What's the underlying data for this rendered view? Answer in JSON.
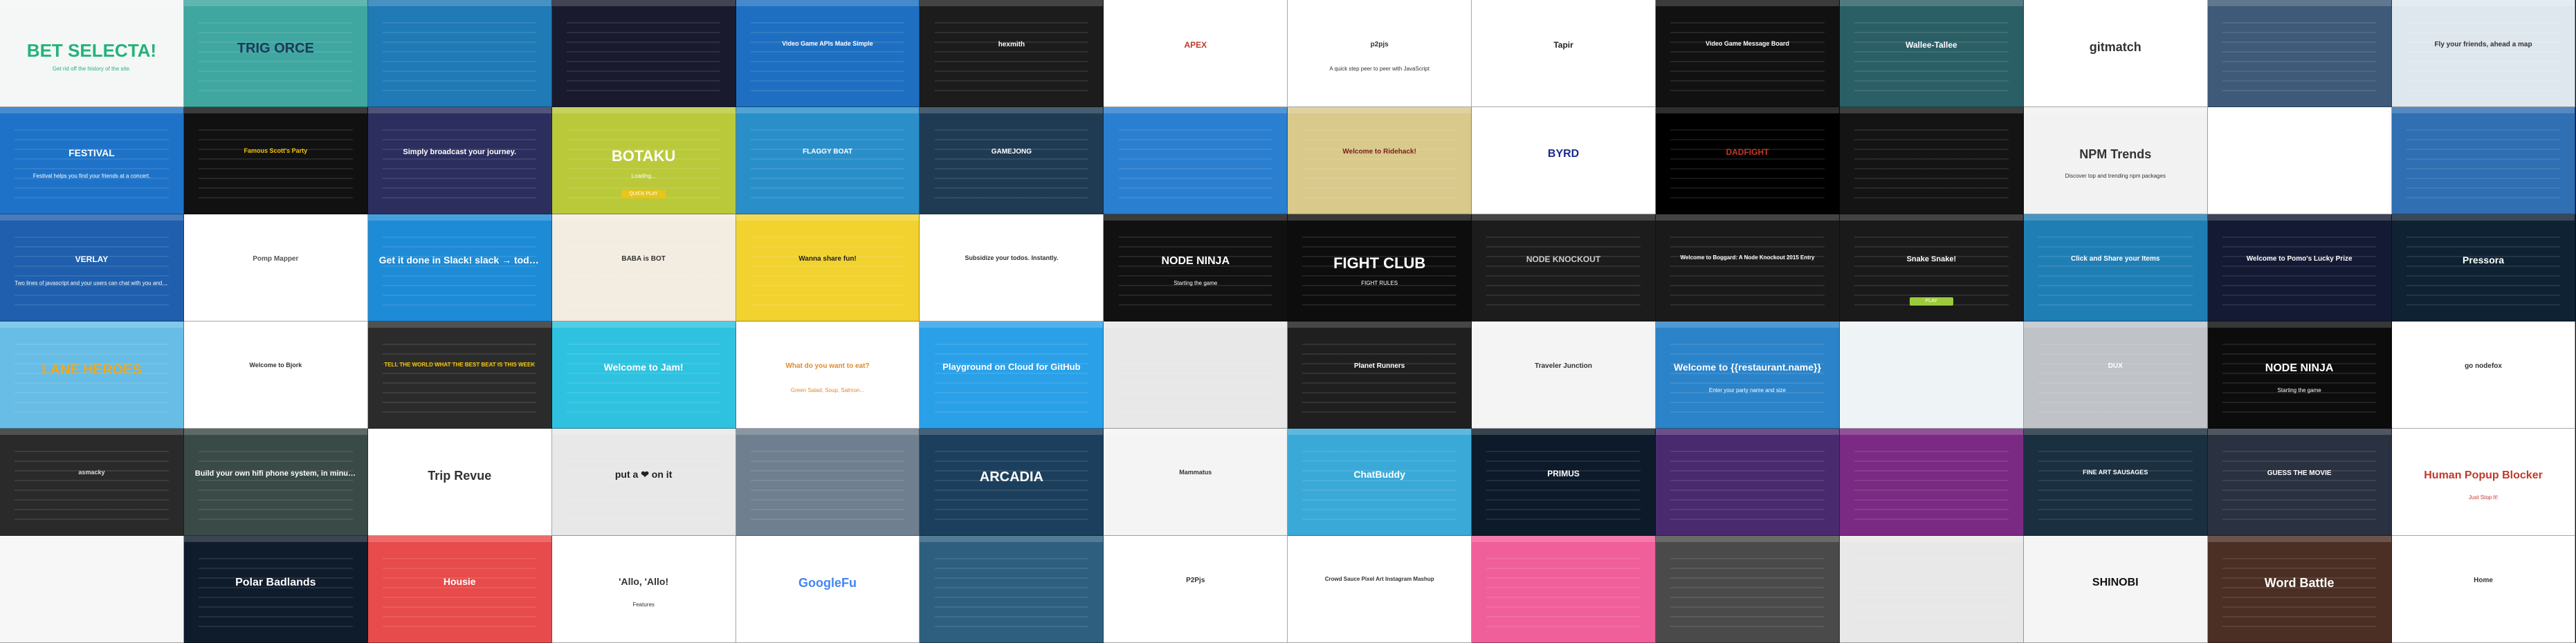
{
  "tiles": [
    {
      "title": "BET SELECTA!",
      "sub": "Get rid off the history of the site.",
      "bg": "#f4f7f6",
      "fg": "#23b27a",
      "btn": "",
      "size": 26
    },
    {
      "title": "TRIG ORCE",
      "sub": "",
      "bg": "#3fa7a0",
      "fg": "#1b3a5a",
      "btn": "",
      "size": 20
    },
    {
      "title": "",
      "sub": "",
      "bg": "#1f7ab5",
      "fg": "#ffffff",
      "btn": "",
      "size": 14
    },
    {
      "title": "",
      "sub": "",
      "bg": "#1a1a2e",
      "fg": "#ffffff",
      "btn": "",
      "size": 12
    },
    {
      "title": "Video Game APIs Made Simple",
      "sub": "",
      "bg": "#1e6fc2",
      "fg": "#ffffff",
      "btn": "",
      "size": 9
    },
    {
      "title": "hexmith",
      "sub": "",
      "bg": "#1c1c1c",
      "fg": "#ffffff",
      "btn": "",
      "size": 10
    },
    {
      "title": "APEX",
      "sub": "",
      "bg": "#ffffff",
      "fg": "#c0392b",
      "btn": "",
      "size": 12
    },
    {
      "title": "p2pjs",
      "sub": "A quick step peer to peer with JavaScript",
      "bg": "#ffffff",
      "fg": "#333333",
      "btn": "",
      "size": 10
    },
    {
      "title": "Tapir",
      "sub": "",
      "bg": "#ffffff",
      "fg": "#222222",
      "btn": "",
      "size": 12
    },
    {
      "title": "Video Game Message Board",
      "sub": "",
      "bg": "#111111",
      "fg": "#ffffff",
      "btn": "",
      "size": 9
    },
    {
      "title": "Wallee-Tallee",
      "sub": "",
      "bg": "#2b5f66",
      "fg": "#ffffff",
      "btn": "",
      "size": 12
    },
    {
      "title": "gitmatch",
      "sub": "",
      "bg": "#ffffff",
      "fg": "#333333",
      "btn": "",
      "size": 18
    },
    {
      "title": "",
      "sub": "",
      "bg": "#3e5a78",
      "fg": "#ffffff",
      "btn": "",
      "size": 12
    },
    {
      "title": "Fly your friends, ahead a map",
      "sub": "",
      "bg": "#dfe7ee",
      "fg": "#333333",
      "btn": "",
      "size": 10
    },
    {
      "title": "FESTIVAL",
      "sub": "Festival helps you find your friends at a concert.",
      "bg": "#1e73c8",
      "fg": "#ffffff",
      "btn": "",
      "size": 14
    },
    {
      "title": "Famous Scott's Party",
      "sub": "",
      "bg": "#111111",
      "fg": "#f1c40f",
      "btn": "",
      "size": 9
    },
    {
      "title": "Simply broadcast your journey.",
      "sub": "",
      "bg": "#2c2f5e",
      "fg": "#ffffff",
      "btn": "",
      "size": 11
    },
    {
      "title": "BOTAKU",
      "sub": "Loading...",
      "bg": "#b9c93a",
      "fg": "#ffffff",
      "btn": "QUICK PLAY",
      "btnbg": "#e8c51a",
      "size": 22
    },
    {
      "title": "FLAGGY BOAT",
      "sub": "",
      "bg": "#2a8fc9",
      "fg": "#ffffff",
      "btn": "",
      "size": 10
    },
    {
      "title": "GAMEJONG",
      "sub": "",
      "bg": "#1f3b54",
      "fg": "#ffffff",
      "btn": "",
      "size": 10
    },
    {
      "title": "",
      "sub": "",
      "bg": "#2b7fd0",
      "fg": "#ffffff",
      "btn": "",
      "size": 12
    },
    {
      "title": "Welcome to Ridehack!",
      "sub": "",
      "bg": "#d9c98a",
      "fg": "#7a1f1f",
      "btn": "",
      "size": 10
    },
    {
      "title": "BYRD",
      "sub": "",
      "bg": "#ffffff",
      "fg": "#1b2a8a",
      "btn": "",
      "size": 16
    },
    {
      "title": "DADFIGHT",
      "sub": "",
      "bg": "#000000",
      "fg": "#c0392b",
      "btn": "",
      "size": 12
    },
    {
      "title": "",
      "sub": "",
      "bg": "#141414",
      "fg": "#ffffff",
      "btn": "",
      "size": 12
    },
    {
      "title": "NPM Trends",
      "sub": "Discover top and trending npm packages",
      "bg": "#f2f2f2",
      "fg": "#333333",
      "btn": "",
      "size": 18
    },
    {
      "title": "",
      "sub": "",
      "bg": "#ffffff",
      "fg": "#333333",
      "btn": "",
      "size": 12
    },
    {
      "title": "",
      "sub": "",
      "bg": "#2f6fb2",
      "fg": "#ffffff",
      "btn": "",
      "size": 12
    },
    {
      "title": "VERLAY",
      "sub": "Two lines of javascript and your users can chat with you and each other",
      "bg": "#1f5fad",
      "fg": "#ffffff",
      "btn": "",
      "size": 12
    },
    {
      "title": "Pomp Mapper",
      "sub": "",
      "bg": "#ffffff",
      "fg": "#555555",
      "btn": "",
      "size": 10
    },
    {
      "title": "Get it done in Slack! slack → todoist",
      "sub": "",
      "bg": "#1e8bd6",
      "fg": "#ffffff",
      "btn": "",
      "size": 14
    },
    {
      "title": "BABA is BOT",
      "sub": "",
      "bg": "#f3ece0",
      "fg": "#333333",
      "btn": "",
      "size": 10
    },
    {
      "title": "Wanna share fun!",
      "sub": "",
      "bg": "#f2d22e",
      "fg": "#222222",
      "btn": "",
      "size": 10
    },
    {
      "title": "Subsidize your todos. Instantly.",
      "sub": "",
      "bg": "#ffffff",
      "fg": "#333333",
      "btn": "",
      "size": 9
    },
    {
      "title": "NODE NINJA",
      "sub": "Starting the game",
      "bg": "#111111",
      "fg": "#ffffff",
      "btn": "",
      "size": 16
    },
    {
      "title": "FIGHT CLUB",
      "sub": "FIGHT RULES",
      "bg": "#0d0d0d",
      "fg": "#ffffff",
      "btn": "",
      "size": 22
    },
    {
      "title": "NODE KNOCKOUT",
      "sub": "",
      "bg": "#1c1c1c",
      "fg": "#cccccc",
      "btn": "",
      "size": 12
    },
    {
      "title": "Welcome to Boggard: A Node Knockout 2015 Entry",
      "sub": "",
      "bg": "#1a1a1a",
      "fg": "#ffffff",
      "btn": "",
      "size": 8
    },
    {
      "title": "Snake Snake!",
      "sub": "",
      "bg": "#1a1a1a",
      "fg": "#ffffff",
      "btn": "PLAY",
      "btnbg": "#9ccc3b",
      "size": 11
    },
    {
      "title": "Click and Share your Items",
      "sub": "",
      "bg": "#1f7fb5",
      "fg": "#ffffff",
      "btn": "",
      "size": 10
    },
    {
      "title": "Welcome to Pomo's Lucky Prize",
      "sub": "",
      "bg": "#141a33",
      "fg": "#ffffff",
      "btn": "",
      "size": 10
    },
    {
      "title": "Pressora",
      "sub": "",
      "bg": "#0f2233",
      "fg": "#ffffff",
      "btn": "",
      "size": 14
    },
    {
      "title": "LANE HEROES",
      "sub": "",
      "bg": "#67bde6",
      "fg": "#f2a81d",
      "btn": "",
      "size": 20
    },
    {
      "title": "Welcome to Bjork",
      "sub": "",
      "bg": "#ffffff",
      "fg": "#333333",
      "btn": "",
      "size": 9
    },
    {
      "title": "TELL THE WORLD WHAT THE BEST BEAT IS THIS WEEK",
      "sub": "",
      "bg": "#2b2b2b",
      "fg": "#f1c40f",
      "btn": "",
      "size": 8
    },
    {
      "title": "Welcome to Jam!",
      "sub": "",
      "bg": "#2ec2e0",
      "fg": "#ffffff",
      "btn": "",
      "size": 14
    },
    {
      "title": "What do you want to eat?",
      "sub": "Green Salad, Soup, Salmon...",
      "bg": "#ffffff",
      "fg": "#e08a2b",
      "btn": "",
      "size": 10
    },
    {
      "title": "Playground on Cloud for GitHub",
      "sub": "",
      "bg": "#2aa0e8",
      "fg": "#ffffff",
      "btn": "",
      "size": 13
    },
    {
      "title": "",
      "sub": "",
      "bg": "#e8e8e8",
      "fg": "#333333",
      "btn": "",
      "size": 12
    },
    {
      "title": "Planet Runners",
      "sub": "",
      "bg": "#1f1f1f",
      "fg": "#ffffff",
      "btn": "",
      "size": 10
    },
    {
      "title": "Traveler Junction",
      "sub": "",
      "bg": "#f4f4f4",
      "fg": "#333333",
      "btn": "",
      "size": 10
    },
    {
      "title": "Welcome to {{restaurant.name}}",
      "sub": "Enter your party name and size",
      "bg": "#2b83c9",
      "fg": "#ffffff",
      "btn": "",
      "size": 14
    },
    {
      "title": "",
      "sub": "",
      "bg": "#eef3f6",
      "fg": "#333333",
      "btn": "",
      "size": 12
    },
    {
      "title": "DUX",
      "sub": "",
      "bg": "#bfc3c7",
      "fg": "#ffffff",
      "btn": "",
      "size": 10
    },
    {
      "title": "NODE NINJA",
      "sub": "Starting the game",
      "bg": "#0c0c0c",
      "fg": "#ffffff",
      "btn": "",
      "size": 16
    },
    {
      "title": "go nodefox",
      "sub": "",
      "bg": "#ffffff",
      "fg": "#333333",
      "btn": "",
      "size": 10
    },
    {
      "title": "asmacky",
      "sub": "",
      "bg": "#2a2a2a",
      "fg": "#dddddd",
      "btn": "",
      "size": 9
    },
    {
      "title": "Build your own hifi phone system, in minutes.",
      "sub": "",
      "bg": "#3a4a46",
      "fg": "#ffffff",
      "btn": "",
      "size": 11
    },
    {
      "title": "Trip Revue",
      "sub": "",
      "bg": "#ffffff",
      "fg": "#333333",
      "btn": "",
      "size": 18
    },
    {
      "title": "put a ❤ on it",
      "sub": "",
      "bg": "#e8e8e8",
      "fg": "#222222",
      "btn": "",
      "size": 14
    },
    {
      "title": "",
      "sub": "",
      "bg": "#6f7f8f",
      "fg": "#ffffff",
      "btn": "",
      "size": 12
    },
    {
      "title": "ARCADIA",
      "sub": "",
      "bg": "#1b3f5c",
      "fg": "#ffffff",
      "btn": "",
      "size": 20
    },
    {
      "title": "Mammatus",
      "sub": "",
      "bg": "#f4f4f4",
      "fg": "#333333",
      "btn": "",
      "size": 9
    },
    {
      "title": "ChatBuddy",
      "sub": "",
      "bg": "#3aa9d8",
      "fg": "#ffffff",
      "btn": "",
      "size": 14
    },
    {
      "title": "PRIMUS",
      "sub": "",
      "bg": "#0d1a2a",
      "fg": "#ffffff",
      "btn": "",
      "size": 12
    },
    {
      "title": "",
      "sub": "",
      "bg": "#4a2a6e",
      "fg": "#ffffff",
      "btn": "",
      "size": 12
    },
    {
      "title": "",
      "sub": "",
      "bg": "#7a2a82",
      "fg": "#ffffff",
      "btn": "",
      "size": 12
    },
    {
      "title": "FINE ART SAUSAGES",
      "sub": "",
      "bg": "#1a2f3f",
      "fg": "#ffffff",
      "btn": "",
      "size": 9
    },
    {
      "title": "GUESS THE MOVIE",
      "sub": "",
      "bg": "#2a3140",
      "fg": "#ffffff",
      "btn": "",
      "size": 10
    },
    {
      "title": "Human Popup Blocker",
      "sub": "Just Stop It!",
      "bg": "#ffffff",
      "fg": "#c0392b",
      "btn": "",
      "size": 16
    },
    {
      "title": "",
      "sub": "",
      "bg": "#f7f7f7",
      "fg": "#333333",
      "btn": "",
      "size": 12
    },
    {
      "title": "Polar Badlands",
      "sub": "",
      "bg": "#0f1c2c",
      "fg": "#ffffff",
      "btn": "",
      "size": 16
    },
    {
      "title": "Housie",
      "sub": "",
      "bg": "#e84b4b",
      "fg": "#ffffff",
      "btn": "",
      "size": 14
    },
    {
      "title": "'Allo, 'Allo!",
      "sub": "Features",
      "bg": "#ffffff",
      "fg": "#333333",
      "btn": "",
      "size": 14
    },
    {
      "title": "GoogleFu",
      "sub": "",
      "bg": "#ffffff",
      "fg": "#4285f4",
      "btn": "",
      "size": 18
    },
    {
      "title": "",
      "sub": "",
      "bg": "#2f5f7f",
      "fg": "#ffffff",
      "btn": "",
      "size": 12
    },
    {
      "title": "P2Pjs",
      "sub": "",
      "bg": "#ffffff",
      "fg": "#333333",
      "btn": "",
      "size": 10
    },
    {
      "title": "Crowd Sauce Pixel Art Instagram Mashup",
      "sub": "",
      "bg": "#ffffff",
      "fg": "#333333",
      "btn": "",
      "size": 8
    },
    {
      "title": "",
      "sub": "",
      "bg": "#f05f9a",
      "fg": "#ffffff",
      "btn": "",
      "size": 12
    },
    {
      "title": "",
      "sub": "",
      "bg": "#4a4a4a",
      "fg": "#ffffff",
      "btn": "",
      "size": 12
    },
    {
      "title": "",
      "sub": "",
      "bg": "#e8e8e8",
      "fg": "#333333",
      "btn": "",
      "size": 12
    },
    {
      "title": "SHINOBI",
      "sub": "",
      "bg": "#f5f5f5",
      "fg": "#111111",
      "btn": "",
      "size": 16
    },
    {
      "title": "Word Battle",
      "sub": "",
      "bg": "#4b2f24",
      "fg": "#ffffff",
      "btn": "",
      "size": 18
    },
    {
      "title": "Home",
      "sub": "",
      "bg": "#ffffff",
      "fg": "#333333",
      "btn": "",
      "size": 10
    }
  ]
}
